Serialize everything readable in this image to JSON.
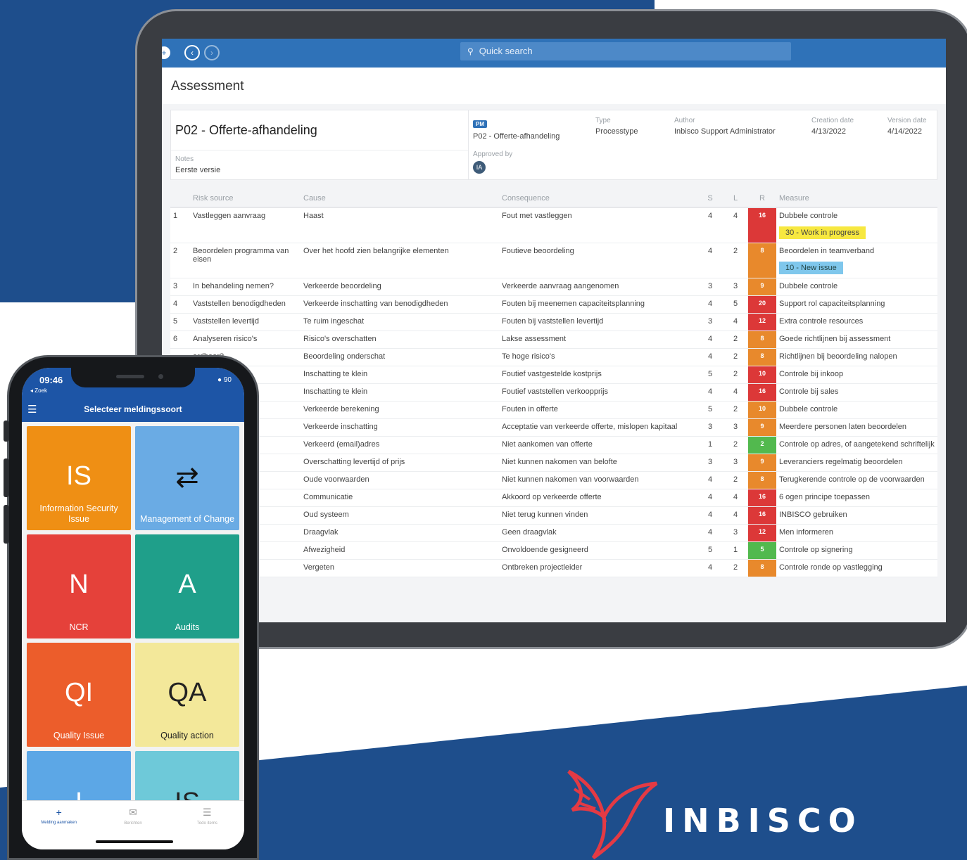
{
  "colors": {
    "brand_blue": "#1e4e8c",
    "app_blue": "#2f72b8",
    "risk_red": "#dc3838",
    "risk_orange": "#e8892c",
    "risk_green": "#52b94e"
  },
  "tablet": {
    "search_placeholder": "Quick search",
    "page_title": "Assessment",
    "process": {
      "title": "P02 - Offerte-afhandeling",
      "notes_label": "Notes",
      "notes": "Eerste versie",
      "badge": "PM",
      "name": "P02 - Offerte-afhandeling",
      "approved_label": "Approved by",
      "approver_initials": "IA",
      "type_label": "Type",
      "type": "Processtype",
      "author_label": "Author",
      "author": "Inbisco Support Administrator",
      "creation_label": "Creation date",
      "creation": "4/13/2022",
      "version_label": "Version date",
      "version": "4/14/2022"
    },
    "columns": [
      "Risk source",
      "Cause",
      "Consequence",
      "S",
      "L",
      "R",
      "Measure"
    ],
    "rows": [
      {
        "n": "1",
        "source": "Vastleggen aanvraag",
        "cause": "Haast",
        "consequence": "Fout met vastleggen",
        "s": "4",
        "l": "4",
        "r": "16",
        "level": "red",
        "measure": "Dubbele controle",
        "tag": "30 - Work in progress",
        "tagcolor": "yellow"
      },
      {
        "n": "2",
        "source": "Beoordelen programma van eisen",
        "cause": "Over het hoofd zien belangrijke elementen",
        "consequence": "Foutieve beoordeling",
        "s": "4",
        "l": "2",
        "r": "8",
        "level": "orange",
        "measure": "Beoordelen in teamverband",
        "tag": "10 - New issue",
        "tagcolor": "blue"
      },
      {
        "n": "3",
        "source": "In behandeling nemen?",
        "cause": "Verkeerde beoordeling",
        "consequence": "Verkeerde aanvraag aangenomen",
        "s": "3",
        "l": "3",
        "r": "9",
        "level": "orange",
        "measure": "Dubbele controle"
      },
      {
        "n": "4",
        "source": "Vaststellen benodigdheden",
        "cause": "Verkeerde inschatting van benodigdheden",
        "consequence": "Fouten bij meenemen capaciteitsplanning",
        "s": "4",
        "l": "5",
        "r": "20",
        "level": "red",
        "measure": "Support rol capaciteitsplanning"
      },
      {
        "n": "5",
        "source": "Vaststellen levertijd",
        "cause": "Te ruim ingeschat",
        "consequence": "Fouten bij vaststellen levertijd",
        "s": "3",
        "l": "4",
        "r": "12",
        "level": "red",
        "measure": "Extra controle resources"
      },
      {
        "n": "6",
        "source": "Analyseren risico's",
        "cause": "Risico's overschatten",
        "consequence": "Lakse assessment",
        "s": "4",
        "l": "2",
        "r": "8",
        "level": "orange",
        "measure": "Goede richtlijnen bij assessment"
      },
      {
        "n": "",
        "source": "ardbaar?",
        "cause": "Beoordeling onderschat",
        "consequence": "Te hoge risico's",
        "s": "4",
        "l": "2",
        "r": "8",
        "level": "orange",
        "measure": "Richtlijnen bij beoordeling nalopen"
      },
      {
        "n": "",
        "source": "is",
        "cause": "Inschatting te klein",
        "consequence": "Foutief vastgestelde kostprijs",
        "s": "5",
        "l": "2",
        "r": "10",
        "level": "red",
        "measure": "Controle bij inkoop"
      },
      {
        "n": "",
        "source": "oprijs",
        "cause": "Inschatting te klein",
        "consequence": "Foutief vaststellen verkoopprijs",
        "s": "4",
        "l": "4",
        "r": "16",
        "level": "red",
        "measure": "Controle bij sales"
      },
      {
        "n": "",
        "source": "eggen",
        "cause": "Verkeerde berekening",
        "consequence": "Fouten in offerte",
        "s": "5",
        "l": "2",
        "r": "10",
        "level": "orange",
        "measure": "Dubbele controle"
      },
      {
        "n": "",
        "source": "",
        "cause": "Verkeerde inschatting",
        "consequence": "Acceptatie van verkeerde offerte, mislopen kapitaal",
        "s": "3",
        "l": "3",
        "r": "9",
        "level": "orange",
        "measure": "Meerdere personen laten beoordelen"
      },
      {
        "n": "",
        "source": "aar klant",
        "cause": "Verkeerd (email)adres",
        "consequence": "Niet aankomen van offerte",
        "s": "1",
        "l": "2",
        "r": "2",
        "level": "green",
        "measure": "Controle op adres, of aangetekend schriftelijk"
      },
      {
        "n": "",
        "source": "s/levertijd",
        "cause": "Overschatting levertijd of prijs",
        "consequence": "Niet kunnen nakomen van belofte",
        "s": "3",
        "l": "3",
        "r": "9",
        "level": "orange",
        "measure": "Leveranciers regelmatig beoordelen"
      },
      {
        "n": "",
        "source": "rige",
        "cause": "Oude voorwaarden",
        "consequence": "Niet kunnen nakomen van voorwaarden",
        "s": "4",
        "l": "2",
        "r": "8",
        "level": "orange",
        "measure": "Terugkerende controle op de voorwaarden"
      },
      {
        "n": "",
        "source": "",
        "cause": "Communicatie",
        "consequence": "Akkoord op verkeerde offerte",
        "s": "4",
        "l": "4",
        "r": "16",
        "level": "red",
        "measure": "6 ogen principe toepassen"
      },
      {
        "n": "",
        "source": "",
        "cause": "Oud systeem",
        "consequence": "Niet terug kunnen vinden",
        "s": "4",
        "l": "4",
        "r": "16",
        "level": "red",
        "measure": "INBISCO gebruiken"
      },
      {
        "n": "",
        "source": "anvraag",
        "cause": "Draagvlak",
        "consequence": "Geen draagvlak",
        "s": "4",
        "l": "3",
        "r": "12",
        "level": "red",
        "measure": "Men informeren"
      },
      {
        "n": "",
        "source": "reenkomst",
        "cause": "Afwezigheid",
        "consequence": "Onvoldoende gesigneerd",
        "s": "5",
        "l": "1",
        "r": "5",
        "level": "green",
        "measure": "Controle op signering"
      },
      {
        "n": "",
        "source": "eider",
        "cause": "Vergeten",
        "consequence": "Ontbreken projectleider",
        "s": "4",
        "l": "2",
        "r": "8",
        "level": "orange",
        "measure": "Controle ronde op vastlegging"
      }
    ]
  },
  "phone": {
    "time": "09:46",
    "back": "◂ Zoek",
    "battery": "90",
    "title": "Selecteer meldingssoort",
    "tiles": [
      {
        "abbr": "IS",
        "name": "Information Security Issue",
        "color": "#ef8f14"
      },
      {
        "abbr": "⇄",
        "name": "Management of Change",
        "color": "#6aabe4"
      },
      {
        "abbr": "N",
        "name": "NCR",
        "color": "#e5413a"
      },
      {
        "abbr": "A",
        "name": "Audits",
        "color": "#1f9f8a"
      },
      {
        "abbr": "QI",
        "name": "Quality Issue",
        "color": "#ec5d2b"
      },
      {
        "abbr": "QA",
        "name": "Quality action",
        "color": "#f3e89a"
      },
      {
        "abbr": "I",
        "name": "",
        "color": "#5ca7e6"
      },
      {
        "abbr": "IS",
        "name": "",
        "color": "#6ec9d9"
      }
    ],
    "nav": [
      {
        "label": "Melding aanmaken",
        "icon": "plus-icon"
      },
      {
        "label": "Berichten",
        "icon": "inbox-icon"
      },
      {
        "label": "Todo items",
        "icon": "list-icon"
      }
    ]
  },
  "logo": {
    "text": "INBISCO"
  }
}
